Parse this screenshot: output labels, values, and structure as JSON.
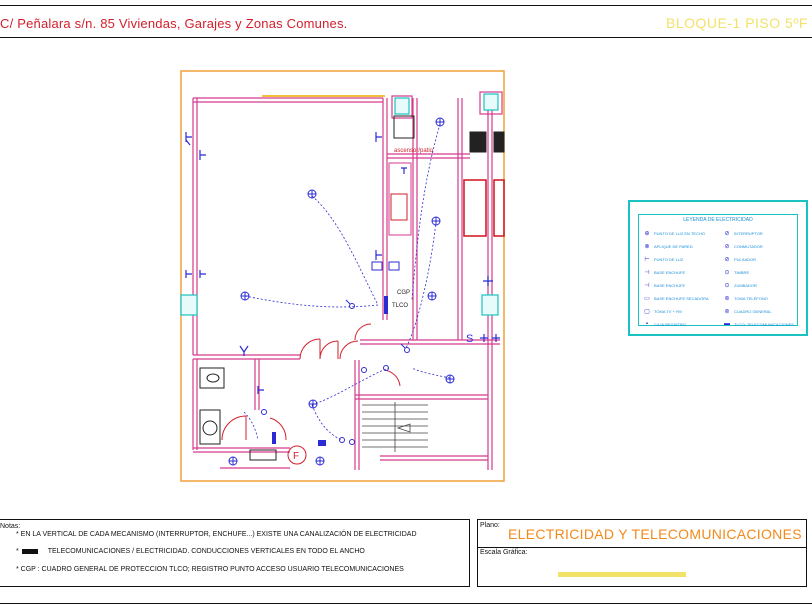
{
  "header": {
    "title": "C/ Peñalara s/n. 85 Viviendas, Garajes y Zonas Comunes.",
    "sheet_code": "BLOQUE-1 PISO 5ºF"
  },
  "plan": {
    "labels": {
      "room_label": "ascensor/patio",
      "cgp": "CGP",
      "tlco": "TLCO",
      "f_marker": "F",
      "s_marker": "S"
    }
  },
  "legend": {
    "title": "LEYENDA DE ELECTRICIDAD",
    "left_items": [
      {
        "symbol": "⊕",
        "label": "PUNTO DE LUZ EN TECHO"
      },
      {
        "symbol": "⊗",
        "label": "APLIQUE DE PARED"
      },
      {
        "symbol": "⊢",
        "label": "PUNTO DE LUZ"
      },
      {
        "symbol": "⊣",
        "label": "BASE ENCHUFE"
      },
      {
        "symbol": "⊣",
        "label": "BASE ENCHUFE"
      },
      {
        "symbol": "▭",
        "label": "BASE ENCHUFE SECADORA"
      },
      {
        "symbol": "▢",
        "label": "TOMA TV + FM"
      },
      {
        "symbol": "▪",
        "label": "CAJA REGISTRO"
      }
    ],
    "right_items": [
      {
        "symbol": "⊘",
        "label": "INTERRUPTOR"
      },
      {
        "symbol": "⊘",
        "label": "CONMUTADOR"
      },
      {
        "symbol": "⊘",
        "label": "PULSADOR"
      },
      {
        "symbol": "⊙",
        "label": "TIMBRE"
      },
      {
        "symbol": "⊙",
        "label": "ZUMBADOR"
      },
      {
        "symbol": "⊚",
        "label": "TOMA TELÉFONO"
      },
      {
        "symbol": "⊚",
        "label": "CUADRO GENERAL"
      },
      {
        "symbol": "▬",
        "label": "TLCO: TELECOMUNICACIONES"
      }
    ]
  },
  "notes": {
    "label": "Notas:",
    "line1": "* EN LA VERTICAL DE CADA MECANISMO (INTERRUPTOR, ENCHUFE...) EXISTE UNA CANALIZACIÓN DE ELECTRICIDAD",
    "line2_prefix": "*",
    "line2_text": "TELECOMUNICACIONES  /  ELECTRICIDAD.     CONDUCCIONES VERTICALES EN TODO EL ANCHO",
    "line3": "* CGP : CUADRO GENERAL DE PROTECCION    TLCO; REGISTRO PUNTO ACCESO USUARIO TELECOMUNICACIONES"
  },
  "plano": {
    "label": "Plano:",
    "title": "ELECTRICIDAD Y TELECOMUNICACIONES",
    "escala_label": "Escala Gráfica:"
  },
  "colors": {
    "wall": "#d63a8c",
    "annotation": "#2b2bd6",
    "red": "#d21f2b",
    "legend_border": "#19c3c3",
    "plano_title": "#f28a1a",
    "sheet_code": "#f3e26a"
  }
}
